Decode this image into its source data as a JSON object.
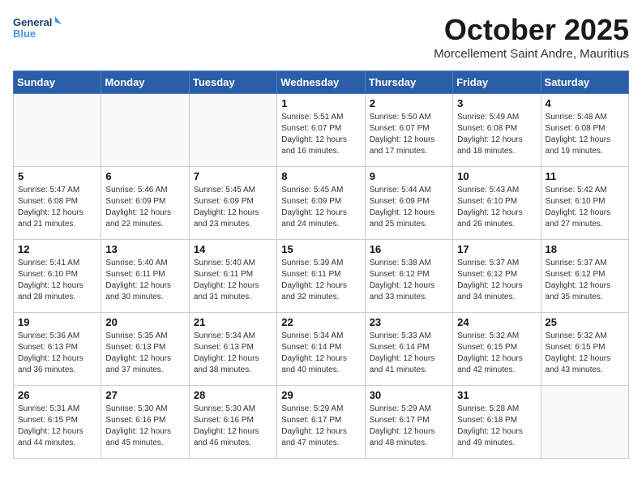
{
  "header": {
    "logo_line1": "General",
    "logo_line2": "Blue",
    "month": "October 2025",
    "location": "Morcellement Saint Andre, Mauritius"
  },
  "weekdays": [
    "Sunday",
    "Monday",
    "Tuesday",
    "Wednesday",
    "Thursday",
    "Friday",
    "Saturday"
  ],
  "weeks": [
    [
      {
        "day": "",
        "info": ""
      },
      {
        "day": "",
        "info": ""
      },
      {
        "day": "",
        "info": ""
      },
      {
        "day": "1",
        "info": "Sunrise: 5:51 AM\nSunset: 6:07 PM\nDaylight: 12 hours and 16 minutes."
      },
      {
        "day": "2",
        "info": "Sunrise: 5:50 AM\nSunset: 6:07 PM\nDaylight: 12 hours and 17 minutes."
      },
      {
        "day": "3",
        "info": "Sunrise: 5:49 AM\nSunset: 6:08 PM\nDaylight: 12 hours and 18 minutes."
      },
      {
        "day": "4",
        "info": "Sunrise: 5:48 AM\nSunset: 6:08 PM\nDaylight: 12 hours and 19 minutes."
      }
    ],
    [
      {
        "day": "5",
        "info": "Sunrise: 5:47 AM\nSunset: 6:08 PM\nDaylight: 12 hours and 21 minutes."
      },
      {
        "day": "6",
        "info": "Sunrise: 5:46 AM\nSunset: 6:09 PM\nDaylight: 12 hours and 22 minutes."
      },
      {
        "day": "7",
        "info": "Sunrise: 5:45 AM\nSunset: 6:09 PM\nDaylight: 12 hours and 23 minutes."
      },
      {
        "day": "8",
        "info": "Sunrise: 5:45 AM\nSunset: 6:09 PM\nDaylight: 12 hours and 24 minutes."
      },
      {
        "day": "9",
        "info": "Sunrise: 5:44 AM\nSunset: 6:09 PM\nDaylight: 12 hours and 25 minutes."
      },
      {
        "day": "10",
        "info": "Sunrise: 5:43 AM\nSunset: 6:10 PM\nDaylight: 12 hours and 26 minutes."
      },
      {
        "day": "11",
        "info": "Sunrise: 5:42 AM\nSunset: 6:10 PM\nDaylight: 12 hours and 27 minutes."
      }
    ],
    [
      {
        "day": "12",
        "info": "Sunrise: 5:41 AM\nSunset: 6:10 PM\nDaylight: 12 hours and 28 minutes."
      },
      {
        "day": "13",
        "info": "Sunrise: 5:40 AM\nSunset: 6:11 PM\nDaylight: 12 hours and 30 minutes."
      },
      {
        "day": "14",
        "info": "Sunrise: 5:40 AM\nSunset: 6:11 PM\nDaylight: 12 hours and 31 minutes."
      },
      {
        "day": "15",
        "info": "Sunrise: 5:39 AM\nSunset: 6:11 PM\nDaylight: 12 hours and 32 minutes."
      },
      {
        "day": "16",
        "info": "Sunrise: 5:38 AM\nSunset: 6:12 PM\nDaylight: 12 hours and 33 minutes."
      },
      {
        "day": "17",
        "info": "Sunrise: 5:37 AM\nSunset: 6:12 PM\nDaylight: 12 hours and 34 minutes."
      },
      {
        "day": "18",
        "info": "Sunrise: 5:37 AM\nSunset: 6:12 PM\nDaylight: 12 hours and 35 minutes."
      }
    ],
    [
      {
        "day": "19",
        "info": "Sunrise: 5:36 AM\nSunset: 6:13 PM\nDaylight: 12 hours and 36 minutes."
      },
      {
        "day": "20",
        "info": "Sunrise: 5:35 AM\nSunset: 6:13 PM\nDaylight: 12 hours and 37 minutes."
      },
      {
        "day": "21",
        "info": "Sunrise: 5:34 AM\nSunset: 6:13 PM\nDaylight: 12 hours and 38 minutes."
      },
      {
        "day": "22",
        "info": "Sunrise: 5:34 AM\nSunset: 6:14 PM\nDaylight: 12 hours and 40 minutes."
      },
      {
        "day": "23",
        "info": "Sunrise: 5:33 AM\nSunset: 6:14 PM\nDaylight: 12 hours and 41 minutes."
      },
      {
        "day": "24",
        "info": "Sunrise: 5:32 AM\nSunset: 6:15 PM\nDaylight: 12 hours and 42 minutes."
      },
      {
        "day": "25",
        "info": "Sunrise: 5:32 AM\nSunset: 6:15 PM\nDaylight: 12 hours and 43 minutes."
      }
    ],
    [
      {
        "day": "26",
        "info": "Sunrise: 5:31 AM\nSunset: 6:15 PM\nDaylight: 12 hours and 44 minutes."
      },
      {
        "day": "27",
        "info": "Sunrise: 5:30 AM\nSunset: 6:16 PM\nDaylight: 12 hours and 45 minutes."
      },
      {
        "day": "28",
        "info": "Sunrise: 5:30 AM\nSunset: 6:16 PM\nDaylight: 12 hours and 46 minutes."
      },
      {
        "day": "29",
        "info": "Sunrise: 5:29 AM\nSunset: 6:17 PM\nDaylight: 12 hours and 47 minutes."
      },
      {
        "day": "30",
        "info": "Sunrise: 5:29 AM\nSunset: 6:17 PM\nDaylight: 12 hours and 48 minutes."
      },
      {
        "day": "31",
        "info": "Sunrise: 5:28 AM\nSunset: 6:18 PM\nDaylight: 12 hours and 49 minutes."
      },
      {
        "day": "",
        "info": ""
      }
    ]
  ]
}
